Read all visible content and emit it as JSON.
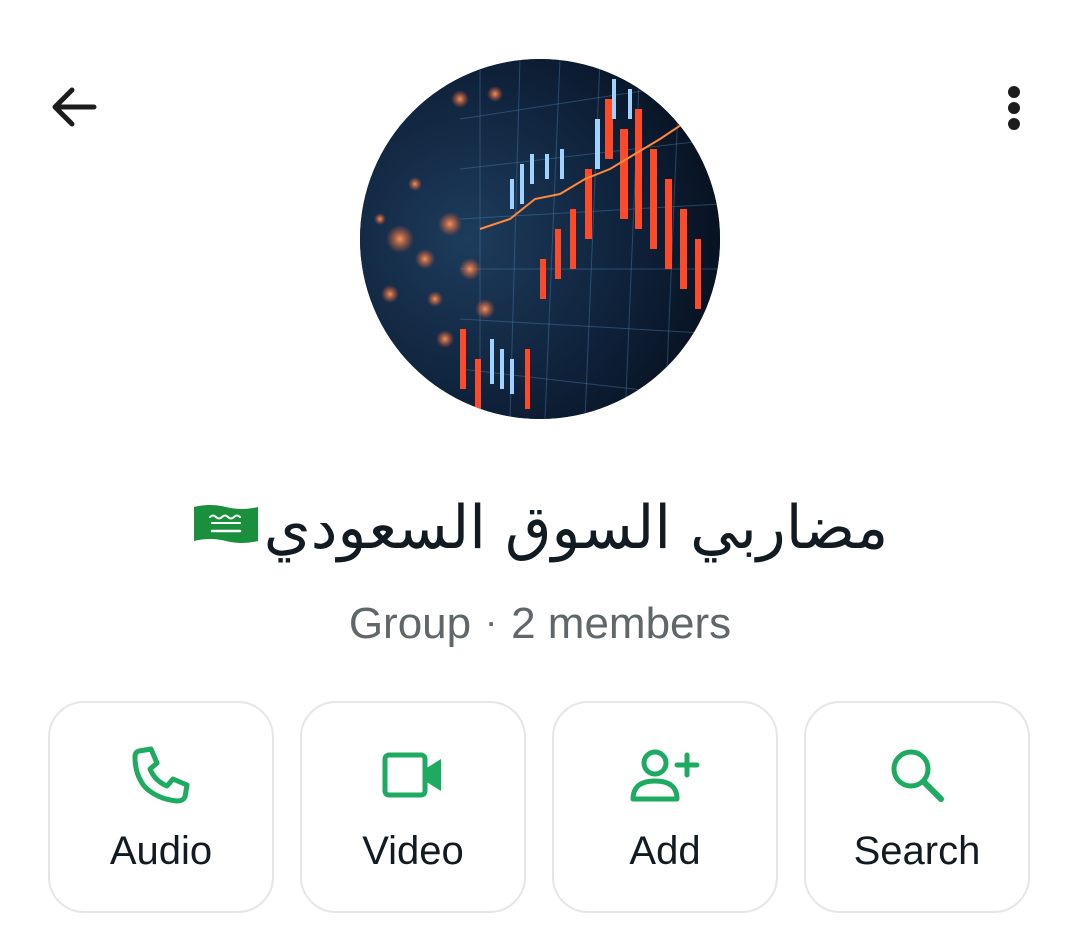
{
  "header": {
    "back_icon": "arrow-left-icon",
    "menu_icon": "more-vertical-icon"
  },
  "group": {
    "name": "مضاربي السوق السعودي",
    "flag_icon": "saudi-arabia-flag-icon",
    "type_label": "Group",
    "separator": "·",
    "members_label": "2 members"
  },
  "actions": [
    {
      "label": "Audio",
      "icon": "phone-icon"
    },
    {
      "label": "Video",
      "icon": "video-camera-icon"
    },
    {
      "label": "Add",
      "icon": "add-person-icon"
    },
    {
      "label": "Search",
      "icon": "search-icon"
    }
  ],
  "colors": {
    "accent": "#1DAA61",
    "text_primary": "#111b21",
    "text_secondary": "#5f676b",
    "card_border": "#e4e6e8",
    "flag_green": "#1a8f3c"
  }
}
